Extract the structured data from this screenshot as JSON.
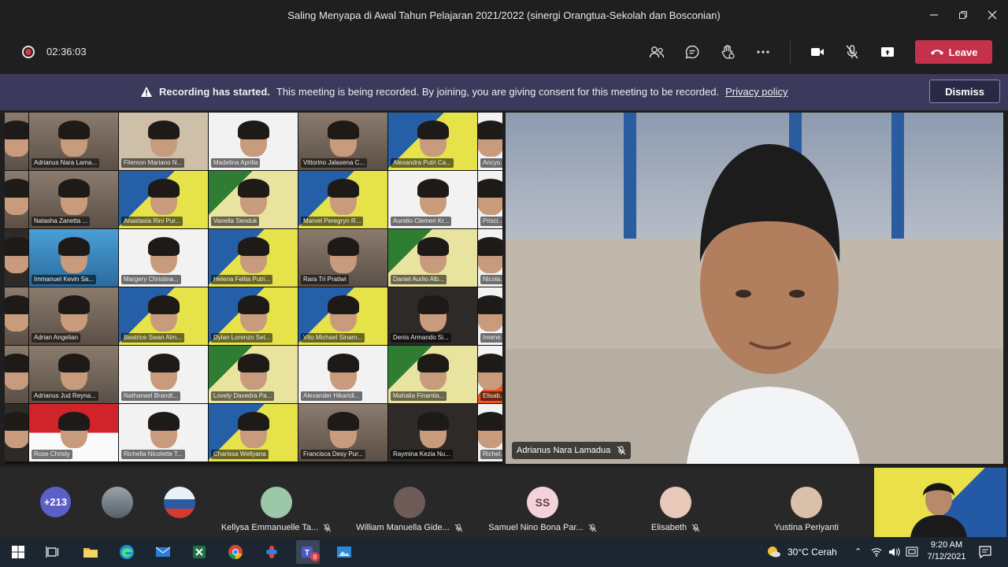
{
  "window": {
    "title": "Saling Menyapa di Awal Tahun Pelajaran 2021/2022 (sinergi Orangtua-Sekolah dan Bosconian)"
  },
  "toolbar": {
    "timer": "02:36:03",
    "leave_label": "Leave"
  },
  "banner": {
    "heading": "Recording has started.",
    "message": "This meeting is being recorded. By joining, you are giving consent for this meeting to be recorded.",
    "link": "Privacy policy",
    "dismiss_label": "Dismiss"
  },
  "gallery": {
    "tiles": [
      {
        "name": "",
        "style": "t-room"
      },
      {
        "name": "Adrianus Nara Lama...",
        "style": "t-room"
      },
      {
        "name": "Filemon Mariano N...",
        "style": "t-beige"
      },
      {
        "name": "Madelina Aprilia",
        "style": "t-white"
      },
      {
        "name": "Vittorino Jalasena C...",
        "style": "t-room"
      },
      {
        "name": "Alexandra Putri Ca...",
        "style": "t-yellow"
      },
      {
        "name": "Ancyo...",
        "style": "t-white"
      },
      {
        "name": "",
        "style": "t-room"
      },
      {
        "name": "Natasha Zanetta ...",
        "style": "t-room"
      },
      {
        "name": "Anastasia Rini Pur...",
        "style": "t-yellow"
      },
      {
        "name": "Vanella Senduk",
        "style": "t-green"
      },
      {
        "name": "Marvel Peregryn R...",
        "style": "t-yellow"
      },
      {
        "name": "Aurelio Clemen Kr...",
        "style": "t-white"
      },
      {
        "name": "Prisci...",
        "style": "t-white"
      },
      {
        "name": "",
        "style": "t-dark"
      },
      {
        "name": "Immanuel Kevin Sa...",
        "style": "t-blue"
      },
      {
        "name": "Margery Christina...",
        "style": "t-white"
      },
      {
        "name": "Helena Felita Putri...",
        "style": "t-yellow"
      },
      {
        "name": "Rara Tri Pratiwi",
        "style": "t-room"
      },
      {
        "name": "Daniel Aurlio Alb...",
        "style": "t-green"
      },
      {
        "name": "Nicola...",
        "style": "t-white"
      },
      {
        "name": "",
        "style": "t-room"
      },
      {
        "name": "Adrian Angelian",
        "style": "t-room"
      },
      {
        "name": "Beatrice Swan Alm...",
        "style": "t-yellow"
      },
      {
        "name": "Dylan Lorenzo Set...",
        "style": "t-yellow"
      },
      {
        "name": "Vito Michael Sinam...",
        "style": "t-yellow"
      },
      {
        "name": "Denis Armando Si...",
        "style": "t-dark"
      },
      {
        "name": "Ireene...",
        "style": "t-white"
      },
      {
        "name": "",
        "style": "t-room"
      },
      {
        "name": "Adrianus Jud Reyna...",
        "style": "t-room"
      },
      {
        "name": "Nathanael Brandt...",
        "style": "t-white"
      },
      {
        "name": "Lovely Davedra Pa...",
        "style": "t-green"
      },
      {
        "name": "Alexander Hikaridi...",
        "style": "t-white"
      },
      {
        "name": "Mahalia Finantia...",
        "style": "t-green"
      },
      {
        "name": "Elisab...",
        "style": "t-orange"
      },
      {
        "name": "",
        "style": "t-dark"
      },
      {
        "name": "Rose Christy",
        "style": "t-flag"
      },
      {
        "name": "Richella Nicolette T...",
        "style": "t-white"
      },
      {
        "name": "Charissa Wellyana",
        "style": "t-yellow"
      },
      {
        "name": "Francisca Desy Pur...",
        "style": "t-room"
      },
      {
        "name": "Raymina Kezia Nu...",
        "style": "t-dark"
      },
      {
        "name": "Richel...",
        "style": "t-white"
      }
    ]
  },
  "speaker": {
    "name": "Adrianus Nara Lamadua"
  },
  "participants": {
    "overflow_count": "+213",
    "cards": [
      {
        "name": "Kellysa Emmanuelle Ta...",
        "initials": "",
        "color": "#9cc7a8"
      },
      {
        "name": "William Manuella Gide...",
        "initials": "",
        "color": "#6d5b57"
      },
      {
        "name": "Samuel Nino Bona Par...",
        "initials": "SS",
        "color": "#f3d3d9"
      },
      {
        "name": "Elisabeth",
        "initials": "",
        "color": "#e8c8b8"
      },
      {
        "name": "Yustina Periyanti",
        "initials": "",
        "color": "#d9c0a8"
      }
    ]
  },
  "taskbar": {
    "weather": "30°C  Cerah",
    "time": "9:20 AM",
    "date": "7/12/2021",
    "teams_badge": "8"
  },
  "colors": {
    "leave": "#c4314b",
    "banner": "#3b3a5c",
    "accent": "#5b5fc7"
  }
}
